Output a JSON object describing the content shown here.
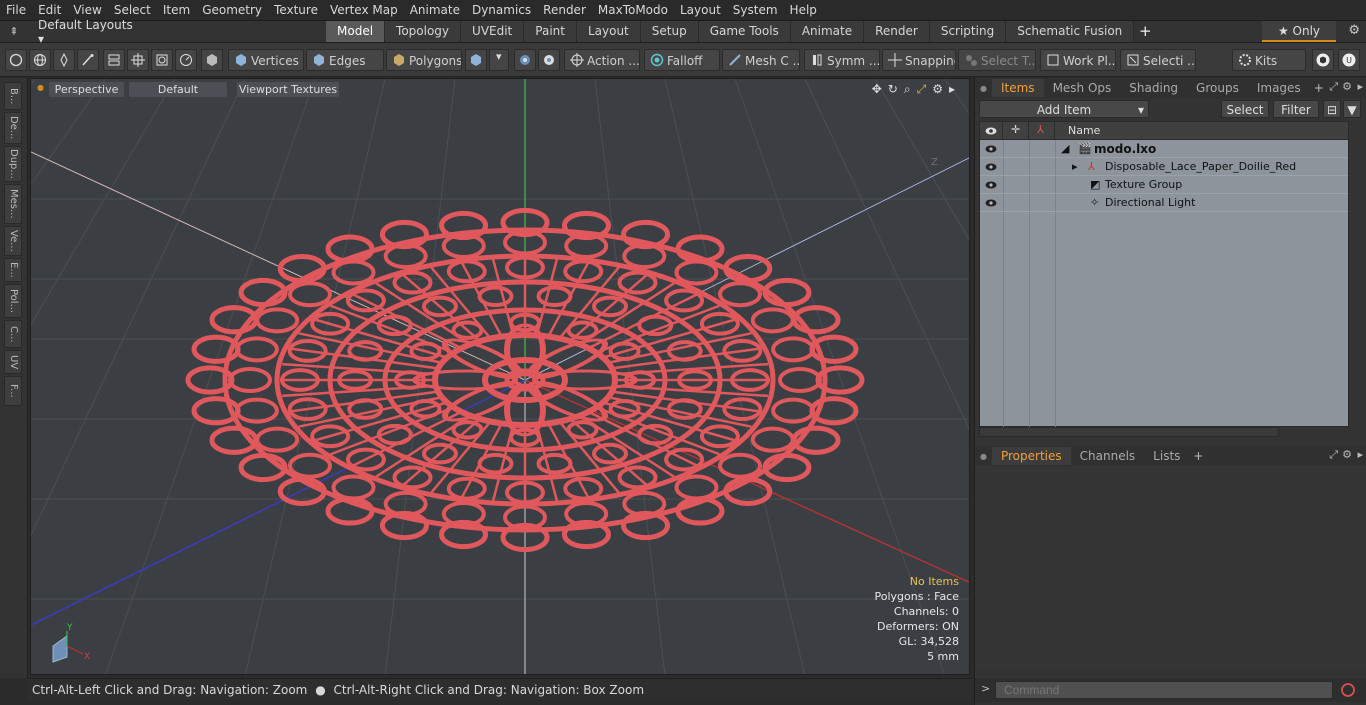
{
  "menu": [
    "File",
    "Edit",
    "View",
    "Select",
    "Item",
    "Geometry",
    "Texture",
    "Vertex Map",
    "Animate",
    "Dynamics",
    "Render",
    "MaxToModo",
    "Layout",
    "System",
    "Help"
  ],
  "layout": {
    "default_layouts": "Default Layouts ▾",
    "tabs": [
      "Model",
      "Topology",
      "UVEdit",
      "Paint",
      "Layout",
      "Setup",
      "Game Tools",
      "Animate",
      "Render",
      "Scripting",
      "Schematic Fusion"
    ],
    "active_tab": "Model",
    "only_label": "★ Only"
  },
  "toolbar": {
    "vertices": "Vertices",
    "edges": "Edges",
    "polygons": "Polygons",
    "action": "Action",
    "falloff": "Falloff",
    "mesh": "Mesh C ...",
    "symm": "Symm ...",
    "snapping": "Snapping",
    "select_t": "Select T...",
    "work_pl": "Work Pl...",
    "selecti": "Selecti ...",
    "kits": "Kits",
    "action_more": "..."
  },
  "left_tabs": [
    "B...",
    "De...",
    "Dup...",
    "Mes...",
    "Ve...",
    "E...",
    "Pol...",
    "C...",
    "UV",
    "F..."
  ],
  "viewport": {
    "perspective": "Perspective",
    "default": "Default",
    "textures": "Viewport Textures",
    "stats": {
      "no_items": "No Items",
      "polygons": "Polygons : Face",
      "channels": "Channels: 0",
      "deformers": "Deformers: ON",
      "gl": "GL: 34,528",
      "units": "5 mm"
    },
    "mesh_color": "#e0585c",
    "axis_y": "Y",
    "axis_x": "X",
    "axis_z": "Z"
  },
  "status": {
    "hint1": "Ctrl-Alt-Left Click and Drag: Navigation: Zoom",
    "hint2": "Ctrl-Alt-Right Click and Drag: Navigation: Box Zoom"
  },
  "items_panel": {
    "tabs": [
      "Items",
      "Mesh Ops",
      "Shading",
      "Groups",
      "Images"
    ],
    "add_item": "Add Item",
    "select": "Select",
    "filter": "Filter",
    "col_name": "Name",
    "rows": [
      {
        "label": "modo.lxo"
      },
      {
        "label": "Disposable_Lace_Paper_Doilie_Red"
      },
      {
        "label": "Texture Group"
      },
      {
        "label": "Directional Light"
      }
    ]
  },
  "properties_panel": {
    "tabs": [
      "Properties",
      "Channels",
      "Lists"
    ]
  },
  "command": {
    "placeholder": "Command"
  }
}
